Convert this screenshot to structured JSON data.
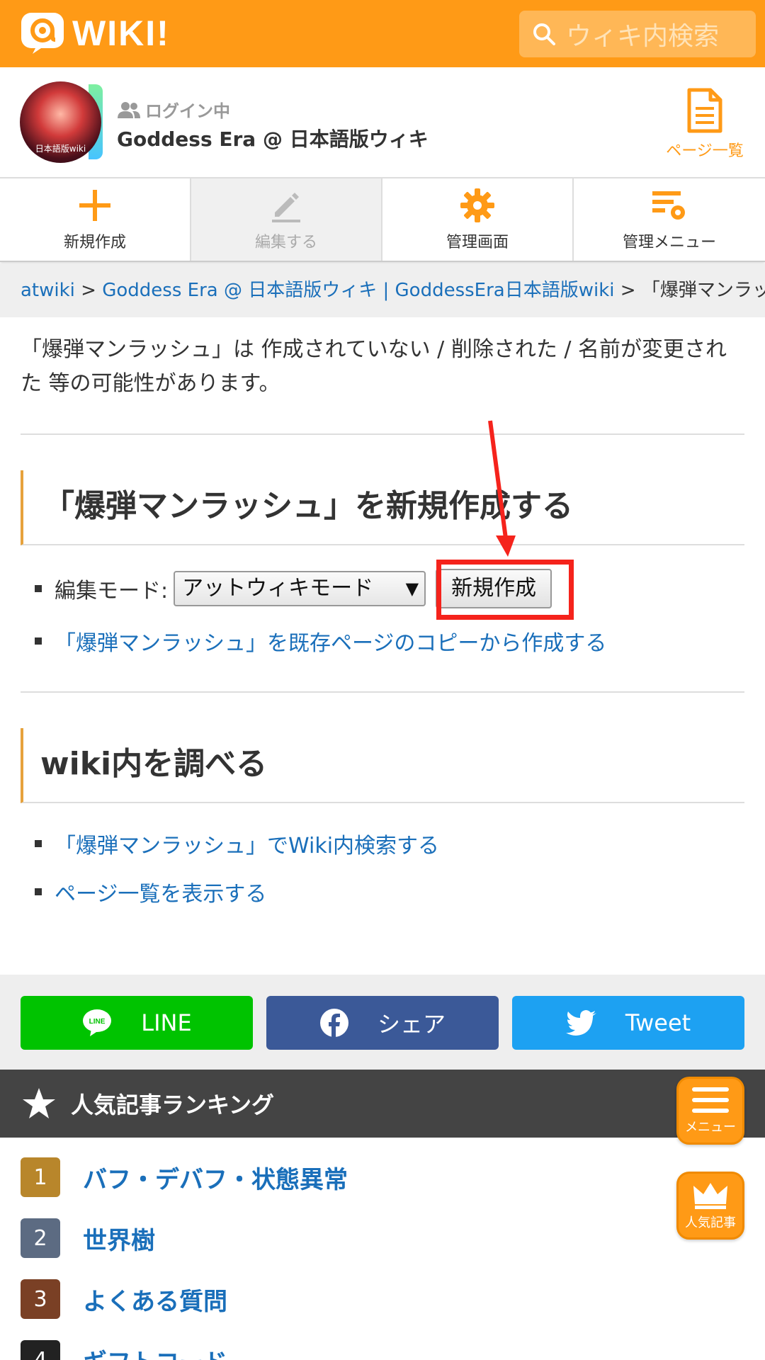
{
  "header": {
    "logo_text": "WIKI!",
    "search_placeholder": "ウィキ内検索"
  },
  "site": {
    "avatar_caption": "日本語版wiki",
    "login_status": "ログイン中",
    "title": "Goddess Era @ 日本語版ウィキ",
    "pages_link": "ページ一覧"
  },
  "toolbar": {
    "new": "新規作成",
    "edit": "編集する",
    "admin": "管理画面",
    "admin_menu": "管理メニュー"
  },
  "breadcrumb": {
    "root": "atwiki",
    "sep1": " > ",
    "site": "Goddess Era @ 日本語版ウィキ | GoddessEra日本語版wiki",
    "sep2": " > ",
    "current": "「爆弾マンラッシュ」"
  },
  "notice": "「爆弾マンラッシュ」は 作成されていない / 削除された / 名前が変更された 等の可能性があります。",
  "create_section": {
    "heading": "「爆弾マンラッシュ」を新規作成する",
    "edit_mode_label": "編集モード:",
    "edit_mode_selected": "アットウィキモード",
    "create_button": "新規作成",
    "copy_link": "「爆弾マンラッシュ」を既存ページのコピーから作成する"
  },
  "search_section": {
    "heading": "wiki内を調べる",
    "search_link": "「爆弾マンラッシュ」でWiki内検索する",
    "pages_link": "ページ一覧を表示する"
  },
  "share": {
    "line": "LINE",
    "facebook": "シェア",
    "twitter": "Tweet"
  },
  "ranking": {
    "heading": "人気記事ランキング",
    "items": [
      {
        "num": "1",
        "title": "バフ・デバフ・状態異常",
        "color": "#B8862B"
      },
      {
        "num": "2",
        "title": "世界樹",
        "color": "#5C6B82"
      },
      {
        "num": "3",
        "title": "よくある質問",
        "color": "#7A4025"
      },
      {
        "num": "4",
        "title": "ギフトコード",
        "color": "#222222"
      }
    ]
  },
  "floating": {
    "menu": "メニュー",
    "popular": "人気記事"
  },
  "colors": {
    "brand_orange": "#FF9A16",
    "link_blue": "#1a6fba",
    "highlight_red": "#F5231C"
  }
}
